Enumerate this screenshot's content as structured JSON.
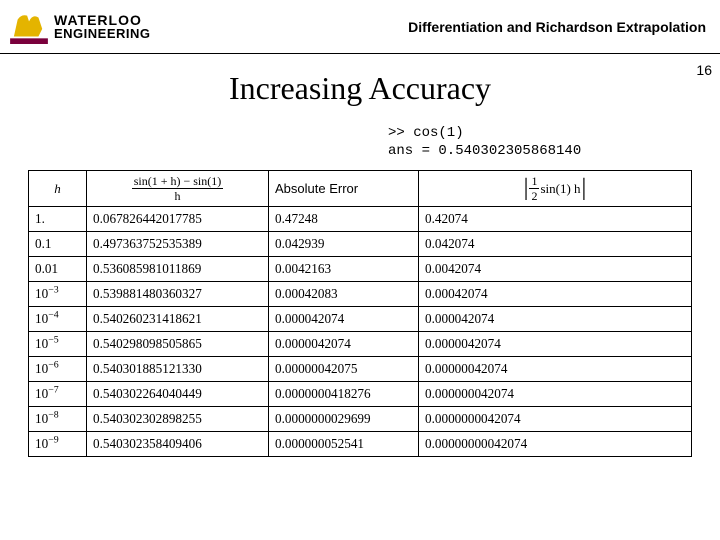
{
  "logo": {
    "line1": "WATERLOO",
    "line2": "ENGINEERING"
  },
  "subtitle": "Differentiation and Richardson Extrapolation",
  "title": "Increasing Accuracy",
  "page_number": "16",
  "code": {
    "l1": ">> cos(1)",
    "l2": "ans = 0.540302305868140"
  },
  "table": {
    "headers": {
      "h": "h",
      "f1_num": "sin(1 + h) − sin(1)",
      "f1_den": "h",
      "abserr": "Absolute Error",
      "f2_frac_num": "1",
      "f2_frac_den": "2",
      "f2_rest": "sin(1) h"
    },
    "rows": [
      {
        "h": "1.",
        "v1": "0.067826442017785",
        "v2": "0.47248",
        "v3": "0.42074"
      },
      {
        "h": "0.1",
        "v1": "0.497363752535389",
        "v2": "0.042939",
        "v3": "0.042074"
      },
      {
        "h": "0.01",
        "v1": "0.536085981011869",
        "v2": "0.0042163",
        "v3": "0.0042074"
      },
      {
        "h_base": "10",
        "h_exp": "−3",
        "v1": "0.539881480360327",
        "v2": "0.00042083",
        "v3": "0.00042074"
      },
      {
        "h_base": "10",
        "h_exp": "−4",
        "v1": "0.540260231418621",
        "v2": "0.000042074",
        "v3": "0.000042074"
      },
      {
        "h_base": "10",
        "h_exp": "−5",
        "v1": "0.540298098505865",
        "v2": "0.0000042074",
        "v3": "0.0000042074"
      },
      {
        "h_base": "10",
        "h_exp": "−6",
        "v1": "0.540301885121330",
        "v2": "0.00000042075",
        "v3": "0.00000042074"
      },
      {
        "h_base": "10",
        "h_exp": "−7",
        "v1": "0.540302264040449",
        "v2": "0.0000000418276",
        "v3": "0.000000042074"
      },
      {
        "h_base": "10",
        "h_exp": "−8",
        "v1": "0.540302302898255",
        "v2": "0.0000000029699",
        "v3": "0.0000000042074"
      },
      {
        "h_base": "10",
        "h_exp": "−9",
        "v1": "0.540302358409406",
        "v2": "0.000000052541",
        "v3": "0.00000000042074"
      }
    ]
  }
}
